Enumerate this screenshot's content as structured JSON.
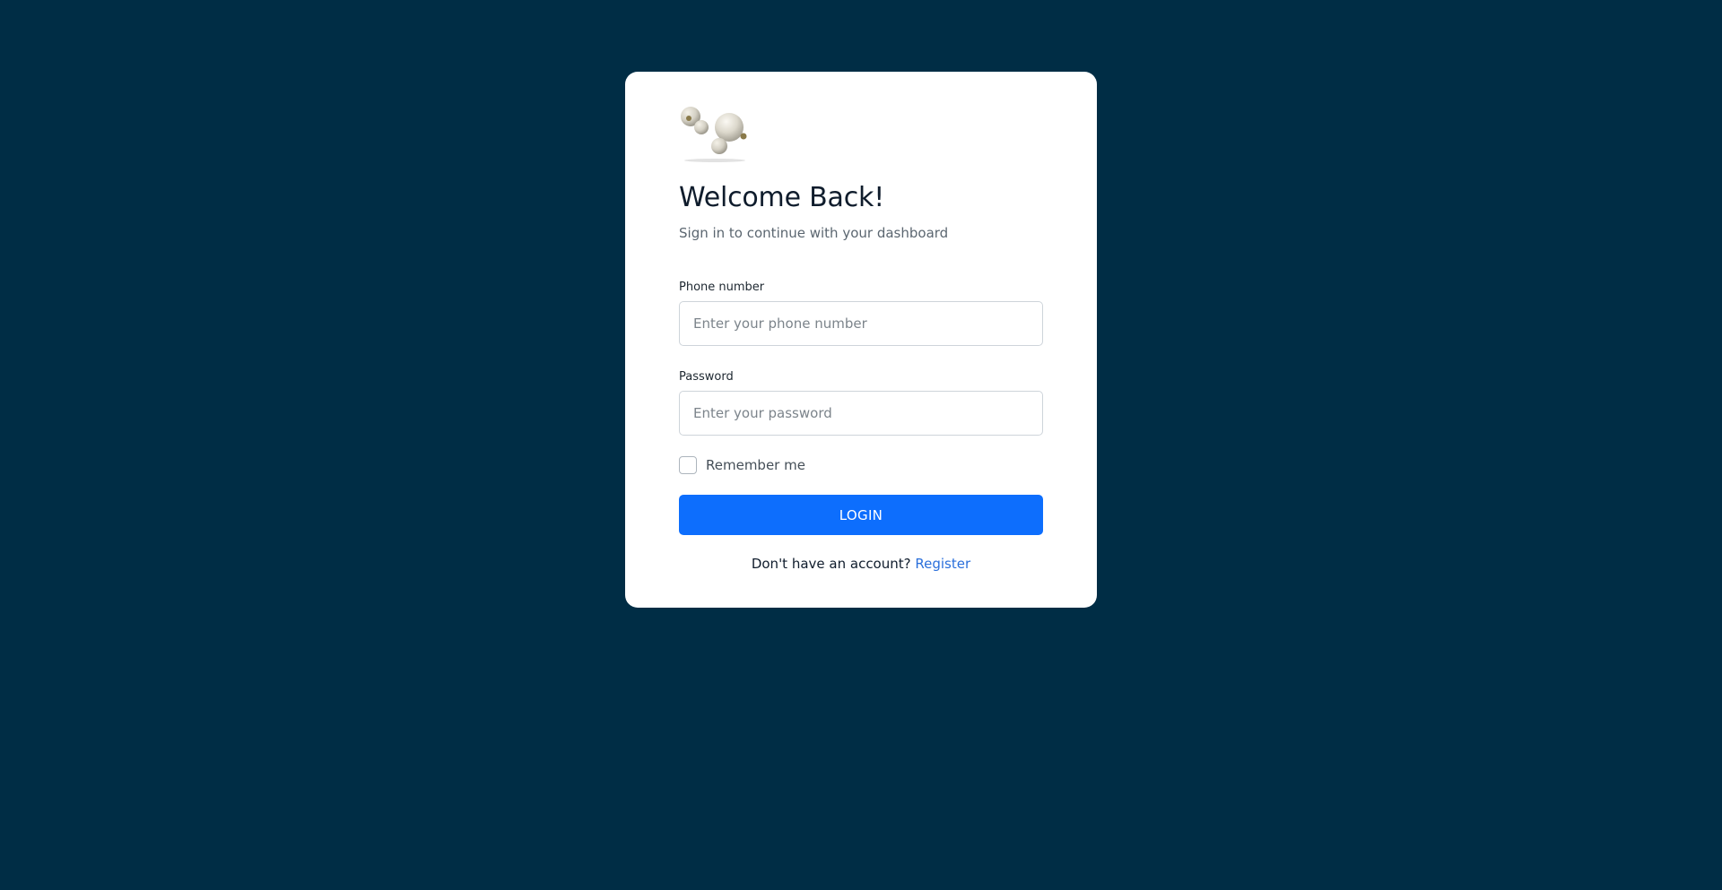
{
  "login": {
    "title": "Welcome Back!",
    "subtitle": "Sign in to continue with your dashboard",
    "phone_label": "Phone number",
    "phone_placeholder": "Enter your phone number",
    "phone_value": "",
    "password_label": "Password",
    "password_placeholder": "Enter your password",
    "password_value": "",
    "remember_label": "Remember me",
    "remember_checked": false,
    "button_label": "LOGIN",
    "footer_text": "Don't have an account?",
    "register_label": "Register"
  },
  "colors": {
    "background": "#002d45",
    "card": "#ffffff",
    "primary": "#0d6efd",
    "link": "#2a6fdb"
  },
  "icons": {
    "logo": "earbuds-logo"
  }
}
